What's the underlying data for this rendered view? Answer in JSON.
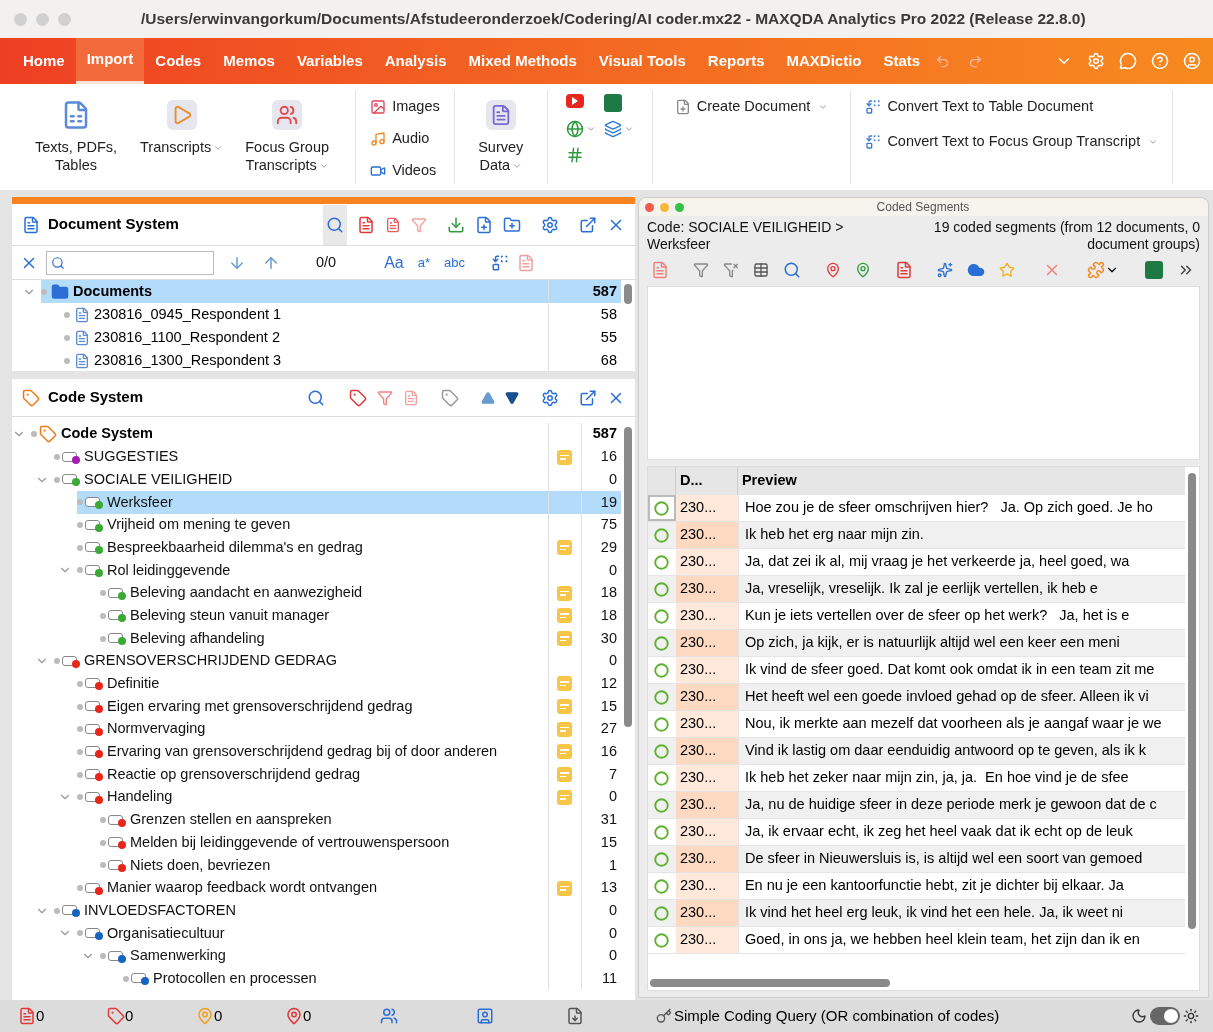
{
  "window": {
    "title": "/Users/erwinvangorkum/Documents/Afstudeeronderzoek/Codering/AI coder.mx22 - MAXQDA Analytics Pro 2022 (Release 22.8.0)"
  },
  "menu_tabs": [
    {
      "label": "Home",
      "selected": false
    },
    {
      "label": "Import",
      "selected": true
    },
    {
      "label": "Codes",
      "selected": false
    },
    {
      "label": "Memos",
      "selected": false
    },
    {
      "label": "Variables",
      "selected": false
    },
    {
      "label": "Analysis",
      "selected": false
    },
    {
      "label": "Mixed Methods",
      "selected": false
    },
    {
      "label": "Visual Tools",
      "selected": false
    },
    {
      "label": "Reports",
      "selected": false
    },
    {
      "label": "MAXDictio",
      "selected": false
    },
    {
      "label": "Stats",
      "selected": false
    }
  ],
  "ribbon": {
    "large_buttons": [
      {
        "kind": "texts",
        "label": "Texts, PDFs, Tables",
        "dropdown": false
      },
      {
        "kind": "transcripts",
        "label": "Transcripts",
        "dropdown": true
      },
      {
        "kind": "focus",
        "label": "Focus Group Transcripts",
        "dropdown": true
      }
    ],
    "media_buttons": [
      {
        "kind": "images",
        "label": "Images"
      },
      {
        "kind": "audio",
        "label": "Audio"
      },
      {
        "kind": "videos",
        "label": "Videos"
      }
    ],
    "survey_button": {
      "label": "Survey Data",
      "dropdown": true
    },
    "create_button": {
      "label": "Create Document",
      "dropdown": true
    },
    "convert_buttons": [
      {
        "label": "Convert Text to Table Document",
        "dropdown": false
      },
      {
        "label": "Convert Text to Focus Group Transcript",
        "dropdown": true
      }
    ]
  },
  "document_system": {
    "title": "Document System",
    "match_count": "0/0",
    "search_options": [
      "Aa",
      "a*",
      "abc"
    ],
    "root": {
      "label": "Documents",
      "count": "587",
      "selected": true,
      "expanded": true,
      "children": [
        {
          "label": "230816_0945_Respondent 1",
          "count": "58",
          "selected": false
        },
        {
          "label": "230816_1100_Respondent 2",
          "count": "55",
          "selected": false
        },
        {
          "label": "230816_1300_Respondent 3",
          "count": "68",
          "selected": false
        }
      ]
    }
  },
  "code_system": {
    "title": "Code System",
    "root": {
      "label": "Code System",
      "count": "587",
      "expanded": true,
      "children": [
        {
          "label": "SUGGESTIES",
          "count": "16",
          "color": "#a21caf",
          "memo": true,
          "selected": false
        },
        {
          "label": "SOCIALE VEILIGHEID",
          "count": "0",
          "color": "#3aa935",
          "memo": false,
          "selected": false,
          "expanded": true,
          "children": [
            {
              "label": "Werksfeer",
              "count": "19",
              "color": "#3aa935",
              "memo": false,
              "selected": true
            },
            {
              "label": "Vrijheid om mening te geven",
              "count": "75",
              "color": "#3aa935",
              "memo": false,
              "selected": false
            },
            {
              "label": "Bespreekbaarheid dilemma's en gedrag",
              "count": "29",
              "color": "#3aa935",
              "memo": true,
              "selected": false
            },
            {
              "label": "Rol leidinggevende",
              "count": "0",
              "color": "#3aa935",
              "memo": false,
              "selected": false,
              "expanded": true,
              "children": [
                {
                  "label": "Beleving aandacht en aanwezigheid",
                  "count": "18",
                  "color": "#3aa935",
                  "memo": true,
                  "selected": false
                },
                {
                  "label": "Beleving steun vanuit manager",
                  "count": "18",
                  "color": "#3aa935",
                  "memo": true,
                  "selected": false
                },
                {
                  "label": "Beleving afhandeling",
                  "count": "30",
                  "color": "#3aa935",
                  "memo": true,
                  "selected": false
                }
              ]
            }
          ]
        },
        {
          "label": "GRENSOVERSCHRIJDEND GEDRAG",
          "count": "0",
          "color": "#e8261c",
          "memo": false,
          "selected": false,
          "expanded": true,
          "children": [
            {
              "label": "Definitie",
              "count": "12",
              "color": "#e8261c",
              "memo": true,
              "selected": false
            },
            {
              "label": "Eigen ervaring met grensoverschrijdend gedrag",
              "count": "15",
              "color": "#e8261c",
              "memo": true,
              "selected": false
            },
            {
              "label": "Normvervaging",
              "count": "27",
              "color": "#e8261c",
              "memo": true,
              "selected": false
            },
            {
              "label": "Ervaring van grensoverschrijdend gedrag bij of door anderen",
              "count": "16",
              "color": "#e8261c",
              "memo": true,
              "selected": false
            },
            {
              "label": "Reactie op grensoverschrijdend gedrag",
              "count": "7",
              "color": "#e8261c",
              "memo": true,
              "selected": false
            },
            {
              "label": "Handeling",
              "count": "0",
              "color": "#e8261c",
              "memo": true,
              "selected": false,
              "expanded": true,
              "children": [
                {
                  "label": "Grenzen stellen en aanspreken",
                  "count": "31",
                  "color": "#e8261c",
                  "memo": false,
                  "selected": false
                },
                {
                  "label": "Melden bij leidinggevende of vertrouwenspersoon",
                  "count": "15",
                  "color": "#e8261c",
                  "memo": false,
                  "selected": false
                },
                {
                  "label": "Niets doen, bevriezen",
                  "count": "1",
                  "color": "#e8261c",
                  "memo": false,
                  "selected": false
                }
              ]
            },
            {
              "label": "Manier waarop feedback wordt ontvangen",
              "count": "13",
              "color": "#e8261c",
              "memo": true,
              "selected": false
            }
          ]
        },
        {
          "label": "INVLOEDSFACTOREN",
          "count": "0",
          "color": "#1565c0",
          "memo": false,
          "selected": false,
          "expanded": true,
          "children": [
            {
              "label": "Organisatiecultuur",
              "count": "0",
              "color": "#1565c0",
              "memo": false,
              "selected": false,
              "expanded": true,
              "children": [
                {
                  "label": "Samenwerking",
                  "count": "0",
                  "color": "#1565c0",
                  "memo": false,
                  "selected": false,
                  "expanded": true,
                  "children": [
                    {
                      "label": "Protocollen en processen",
                      "count": "11",
                      "color": "#1565c0",
                      "memo": false,
                      "selected": false
                    }
                  ]
                }
              ]
            }
          ]
        }
      ]
    }
  },
  "coded_segments": {
    "title": "Coded Segments",
    "code_label": "Code: SOCIALE VEILIGHEID > Werksfeer",
    "summary": "19 coded segments (from 12 documents, 0 document groups)",
    "columns": [
      "D...",
      "Preview"
    ],
    "rows": [
      {
        "document": "230...",
        "preview": "Hoe zou je de sfeer omschrijven hier?   Ja. Op zich goed. Je ho",
        "selected": true
      },
      {
        "document": "230...",
        "preview": "Ik heb het erg naar mijn zin.",
        "selected": false
      },
      {
        "document": "230...",
        "preview": "Ja, dat zei ik al, mij vraag je het verkeerde ja, heel goed, wa",
        "selected": false
      },
      {
        "document": "230...",
        "preview": "Ja, vreselijk, vreselijk. Ik zal je eerlijk vertellen, ik heb e",
        "selected": false
      },
      {
        "document": "230...",
        "preview": "Kun je iets vertellen over de sfeer op het werk?   Ja, het is e",
        "selected": false
      },
      {
        "document": "230...",
        "preview": "Op zich, ja kijk, er is natuurlijk altijd wel een keer een meni",
        "selected": false
      },
      {
        "document": "230...",
        "preview": "Ik vind de sfeer goed. Dat komt ook omdat ik in een team zit me",
        "selected": false
      },
      {
        "document": "230...",
        "preview": "Het heeft wel een goede invloed gehad op de sfeer. Alleen ik vi",
        "selected": false
      },
      {
        "document": "230...",
        "preview": "Nou, ik merkte aan mezelf dat voorheen als je aangaf waar je we",
        "selected": false
      },
      {
        "document": "230...",
        "preview": "Vind ik lastig om daar eenduidig antwoord op te geven, als ik k",
        "selected": false
      },
      {
        "document": "230...",
        "preview": "Ik heb het zeker naar mijn zin, ja, ja.  En hoe vind je de sfee",
        "selected": false
      },
      {
        "document": "230...",
        "preview": "Ja, nu de huidige sfeer in deze periode merk je gewoon dat de c",
        "selected": false
      },
      {
        "document": "230...",
        "preview": "Ja, ik ervaar echt, ik zeg het heel vaak dat ik echt op de leuk",
        "selected": false
      },
      {
        "document": "230...",
        "preview": "De sfeer in Nieuwersluis is, is altijd wel een soort van gemoed",
        "selected": false
      },
      {
        "document": "230...",
        "preview": "En nu je een kantoorfunctie hebt, zit je dichter bij elkaar. Ja",
        "selected": false
      },
      {
        "document": "230...",
        "preview": "Ik vind het heel erg leuk, ik vind het een hele. Ja, ik weet ni",
        "selected": false
      },
      {
        "document": "230...",
        "preview": "Goed, in ons ja, we hebben heel klein team, het zijn dan ik en",
        "selected": false
      }
    ]
  },
  "status_bar": {
    "counters": [
      {
        "kind": "documents",
        "count": "0"
      },
      {
        "kind": "codes",
        "count": "0"
      },
      {
        "kind": "memos",
        "count": "0"
      },
      {
        "kind": "segments",
        "count": "0"
      }
    ],
    "query_label": "Simple Coding Query (OR combination of codes)",
    "theme_toggle": {
      "on": true
    }
  }
}
